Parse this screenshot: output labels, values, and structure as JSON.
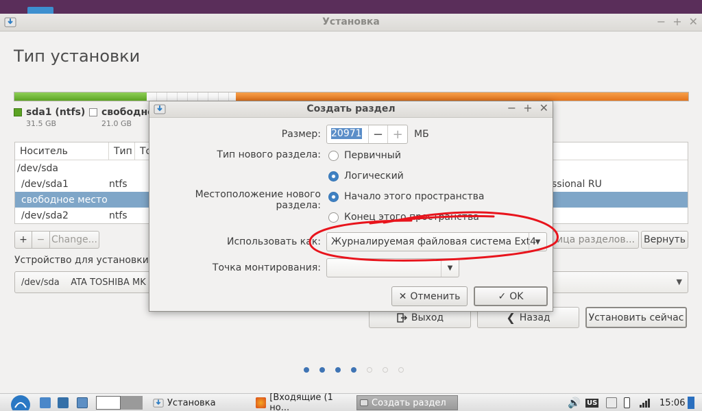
{
  "window": {
    "title": "Установка",
    "page_title": "Тип установки"
  },
  "legend": [
    {
      "name": "sda1 (ntfs)",
      "size": "31.5 GB",
      "color": "#5ca324"
    },
    {
      "name": "свободно",
      "size": "21.0 GB",
      "color": "#ffffff"
    }
  ],
  "table": {
    "headers": [
      "Носитель",
      "Тип",
      "То"
    ],
    "rows": [
      {
        "device": "/dev/sda",
        "type": "",
        "extra": ""
      },
      {
        "device": "/dev/sda1",
        "type": "ntfs",
        "extra": "ssional RU"
      },
      {
        "device": "свободное место",
        "type": "",
        "extra": ""
      },
      {
        "device": "/dev/sda2",
        "type": "ntfs",
        "extra": ""
      }
    ]
  },
  "table_buttons": {
    "add": "+",
    "remove": "−",
    "change": "Change..."
  },
  "right_buttons": {
    "new_table": "ица разделов...",
    "revert": "Вернуть"
  },
  "device": {
    "label": "Устройство для установки си",
    "value": "/dev/sda    ATA TOSHIBA MK"
  },
  "bottom_buttons": {
    "quit": "Выход",
    "back": "Назад",
    "install": "Установить сейчас"
  },
  "progress": {
    "steps_total": 7,
    "steps_current": 4
  },
  "dialog": {
    "title": "Создать раздел",
    "size_label": "Размер:",
    "size_value": "20971",
    "size_unit": "МБ",
    "type_label": "Тип нового раздела:",
    "type_primary": "Первичный",
    "type_logical": "Логический",
    "type_selected": "Логический",
    "location_label": "Местоположение нового раздела:",
    "location_start": "Начало этого пространства",
    "location_end": "Конец этого пространства",
    "location_selected": "Начало этого пространства",
    "use_as_label": "Использовать как:",
    "use_as_value": "Журналируемая файловая система Ext4",
    "mount_label": "Точка монтирования:",
    "mount_value": "",
    "cancel": "Отменить",
    "ok": "OK"
  },
  "taskbar": {
    "tasks": [
      {
        "label": "Установка",
        "active": false
      },
      {
        "label": "[Входящие (1 но...",
        "active": false
      },
      {
        "label": "Создать раздел",
        "active": true
      }
    ],
    "keyboard": "US",
    "clock": "15:06"
  },
  "colors": {
    "accent": "#3f74b4",
    "selection": "#7fa6c8",
    "ntfs": "#5ca324",
    "sda2": "#e4741c",
    "annotation": "#e8141c"
  }
}
